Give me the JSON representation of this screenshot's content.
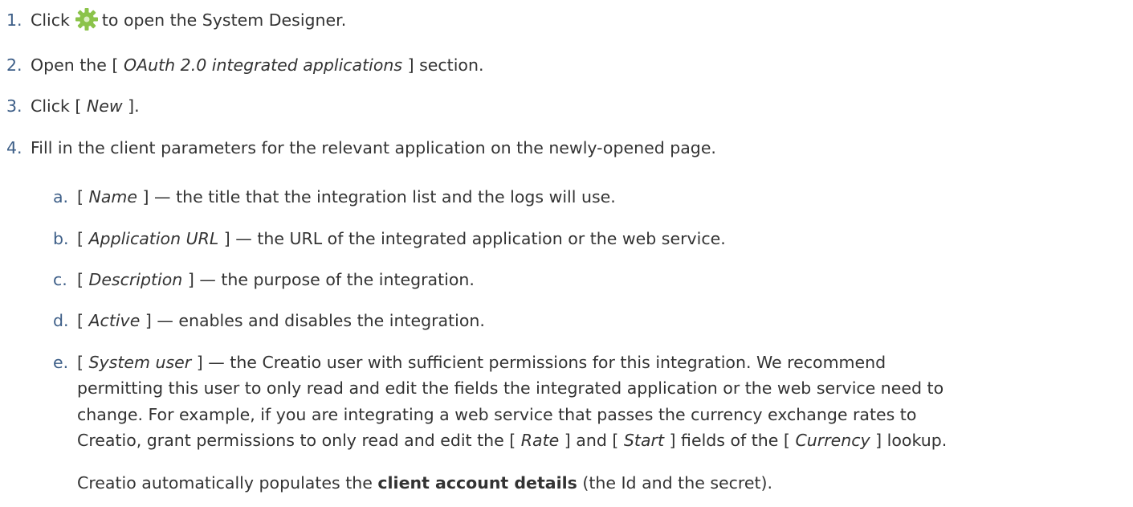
{
  "steps": [
    {
      "marker": "1.",
      "pre": "Click",
      "icon": "gear-icon",
      "icon_color": "#8bc34a",
      "post": "to open the System Designer."
    },
    {
      "marker": "2.",
      "pre": "Open the [",
      "em": "OAuth 2.0 integrated applications",
      "post": "] section."
    },
    {
      "marker": "3.",
      "pre": "Click [",
      "em": "New",
      "post": "]."
    },
    {
      "marker": "4.",
      "text": "Fill in the client parameters for the relevant application on the newly-opened page."
    }
  ],
  "substeps": [
    {
      "marker": "a.",
      "pre": "[",
      "em": "Name",
      "post": "] — the title that the integration list and the logs will use."
    },
    {
      "marker": "b.",
      "pre": "[",
      "em": "Application URL",
      "post": "] — the URL of the integrated application or the web service."
    },
    {
      "marker": "c.",
      "pre": "[",
      "em": "Description",
      "post": "] — the purpose of the integration."
    },
    {
      "marker": "d.",
      "pre": "[",
      "em": "Active",
      "post": "] — enables and disables the integration."
    },
    {
      "marker": "e.",
      "pre": "[",
      "em": "System user",
      "post": "] — the Creatio user with sufficient permissions for this integration. We recommend",
      "line2": "permitting this user to only read and edit the fields the integrated application or the web service need to",
      "line3": "change. For example, if you are integrating a web service that passes the currency exchange rates to",
      "line4_a": "Creatio, grant permissions to only read and edit the [",
      "line4_em1": "Rate",
      "line4_b": "] and [",
      "line4_em2": "Start",
      "line4_c": "] fields of the [",
      "line4_em3": "Currency",
      "line4_d": "] lookup."
    }
  ],
  "note": {
    "pre": "Creatio automatically populates the",
    "bold": "client account details",
    "post": "(the Id and the secret)."
  }
}
